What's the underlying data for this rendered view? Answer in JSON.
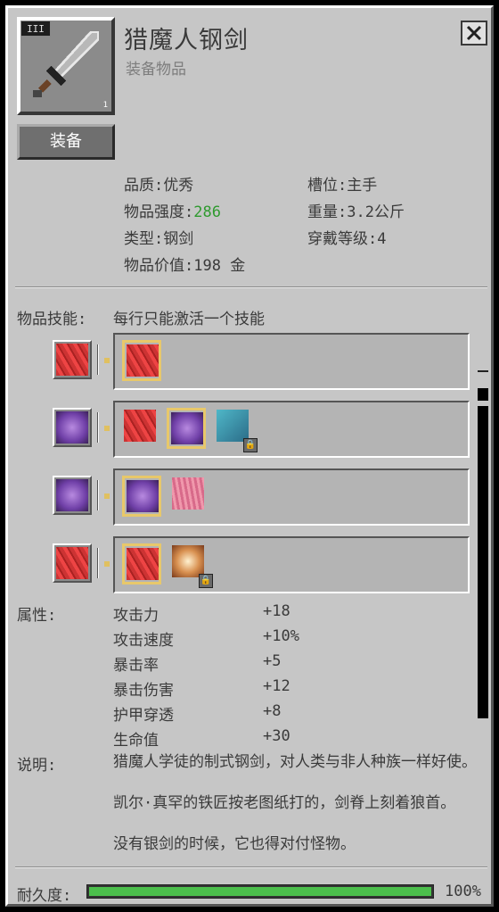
{
  "item": {
    "tier": "III",
    "stack_count": "1",
    "name": "猎魔人钢剑",
    "category": "装备物品",
    "equip_label": "装备"
  },
  "stats": {
    "quality_label": "品质:",
    "quality_value": "优秀",
    "slot_label": "槽位:",
    "slot_value": "主手",
    "strength_label": "物品强度:",
    "strength_value": "286",
    "weight_label": "重量:",
    "weight_value": "3.2公斤",
    "type_label": "类型:",
    "type_value": "钢剑",
    "level_label": "穿戴等级:",
    "level_value": "4",
    "price_label": "物品价值:",
    "price_value": "198 金"
  },
  "skills": {
    "label": "物品技能:",
    "hint": "每行只能激活一个技能",
    "rows": [
      {
        "sub": "左",
        "options": [
          {
            "icon": "sword-slash-icon",
            "selected": true,
            "locked": false
          }
        ]
      },
      {
        "sub": "9",
        "options": [
          {
            "icon": "sword-icon",
            "selected": false,
            "locked": false
          },
          {
            "icon": "crossed-swords-icon",
            "selected": true,
            "locked": false
          },
          {
            "icon": "winged-boot-icon",
            "selected": false,
            "locked": true
          }
        ]
      },
      {
        "sub": "E",
        "options": [
          {
            "icon": "crossed-swords-icon",
            "selected": true,
            "locked": false
          },
          {
            "icon": "boot-icon",
            "selected": false,
            "locked": false
          }
        ]
      },
      {
        "sub": "R",
        "options": [
          {
            "icon": "claw-slash-icon",
            "selected": true,
            "locked": false
          },
          {
            "icon": "shield-orb-icon",
            "selected": false,
            "locked": true
          }
        ]
      }
    ]
  },
  "attributes": {
    "label": "属性:",
    "items": [
      {
        "name": "攻击力",
        "value": "+18"
      },
      {
        "name": "攻击速度",
        "value": "+10%"
      },
      {
        "name": "暴击率",
        "value": "+5"
      },
      {
        "name": "暴击伤害",
        "value": "+12"
      },
      {
        "name": "护甲穿透",
        "value": "+8"
      },
      {
        "name": "生命值",
        "value": "+30"
      }
    ]
  },
  "description": {
    "label": "说明:",
    "lines": [
      "猎魔人学徒的制式钢剑，对人类与非人种族一样好使。",
      "凯尔·真罕的铁匠按老图纸打的，剑脊上刻着狼首。",
      "没有银剑的时候，它也得对付怪物。"
    ]
  },
  "durability": {
    "label": "耐久度:",
    "value": "100%",
    "fraction": 1.0
  },
  "colors": {
    "panel": "#c6c6c6",
    "green": "#2f9a2f",
    "bar": "#4cbf4c",
    "select": "#e8c86a"
  }
}
